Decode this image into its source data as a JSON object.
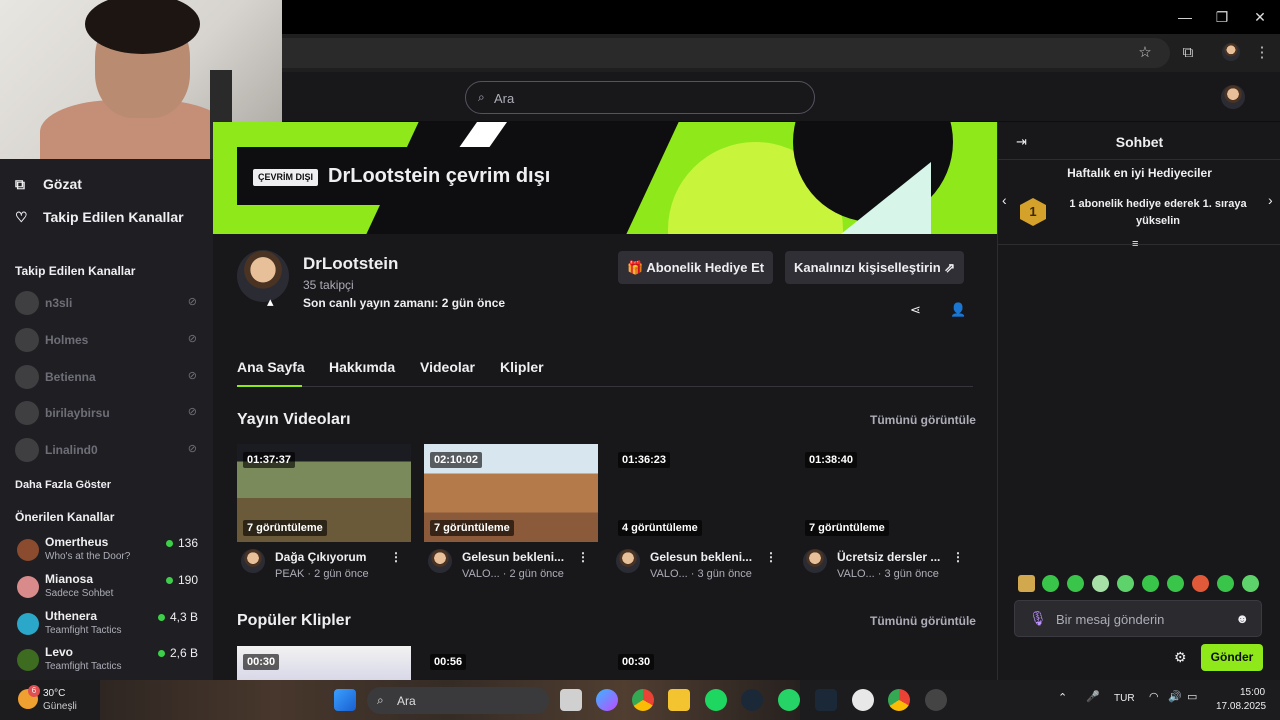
{
  "browser": {
    "window_controls": {
      "minimize": "—",
      "maximize": "❐",
      "close": "✕"
    },
    "toolbar_icons": {
      "bookmark": "☆",
      "extensions": "⧉",
      "menu": "⋮"
    }
  },
  "topnav": {
    "search_placeholder": "Ara"
  },
  "sidebar": {
    "nav": [
      {
        "label": "Gözat",
        "icon": "browse-icon"
      },
      {
        "label": "Takip Edilen Kanallar",
        "icon": "heart-icon"
      }
    ],
    "followed_title": "Takip Edilen Kanallar",
    "followed": [
      "n3sli",
      "Holmes",
      "Betienna",
      "birilaybirsu",
      "Linalind0"
    ],
    "show_more": "Daha Fazla Göster",
    "recommended_title": "Önerilen Kanallar",
    "recommended": [
      {
        "name": "Omertheus",
        "game": "Who's at the Door?",
        "viewers": "136",
        "color": "#8a4b2e"
      },
      {
        "name": "Mianosa",
        "game": "Sadece Sohbet",
        "viewers": "190",
        "color": "#d98a8a"
      },
      {
        "name": "Uthenera",
        "game": "Teamfight Tactics",
        "viewers": "4,3 B",
        "color": "#2aa7c9"
      },
      {
        "name": "Levo",
        "game": "Teamfight Tactics",
        "viewers": "2,6 B",
        "color": "#3d6b1f"
      }
    ]
  },
  "banner": {
    "badge": "ÇEVRİM DIŞI",
    "title": "DrLootstein çevrim dışı"
  },
  "channel": {
    "name": "DrLootstein",
    "followers": "35 takipçi",
    "last_live": "Son canlı yayın zamanı: 2 gün önce",
    "gift_button": "Abonelik Hediye Et",
    "customize_button": "Kanalınızı kişiselleştirin",
    "tabs": [
      "Ana Sayfa",
      "Hakkımda",
      "Videolar",
      "Klipler"
    ]
  },
  "videos": {
    "title": "Yayın Videoları",
    "see_all": "Tümünü görüntüle",
    "items": [
      {
        "duration": "01:37:37",
        "views": "7 görüntüleme",
        "title": "Dağa Çıkıyorum",
        "category": "PEAK",
        "age": "· 2 gün önce"
      },
      {
        "duration": "02:10:02",
        "views": "7 görüntüleme",
        "title": "Gelesun bekleni...",
        "category": "VALO...",
        "age": "· 2 gün önce"
      },
      {
        "duration": "01:36:23",
        "views": "4 görüntüleme",
        "title": "Gelesun bekleni...",
        "category": "VALO...",
        "age": "· 3 gün önce"
      },
      {
        "duration": "01:38:40",
        "views": "7 görüntüleme",
        "title": "Ücretsiz dersler ...",
        "category": "VALO...",
        "age": "· 3 gün önce"
      }
    ]
  },
  "clips": {
    "title": "Popüler Klipler",
    "see_all": "Tümünü görüntüle",
    "durations": [
      "00:30",
      "00:56",
      "00:30"
    ]
  },
  "chat": {
    "title": "Sohbet",
    "gifters_title": "Haftalık en iyi Hediyeciler",
    "rank": "1",
    "gift_prompt": "1 abonelik hediye ederek 1. sıraya yükselin",
    "input_placeholder": "Bir mesaj gönderin",
    "send": "Gönder"
  },
  "taskbar": {
    "weather_temp": "30°C",
    "weather_desc": "Güneşli",
    "weather_badge": "6",
    "search": "Ara",
    "lang": "TUR",
    "time": "15:00",
    "date": "17.08.2025"
  }
}
